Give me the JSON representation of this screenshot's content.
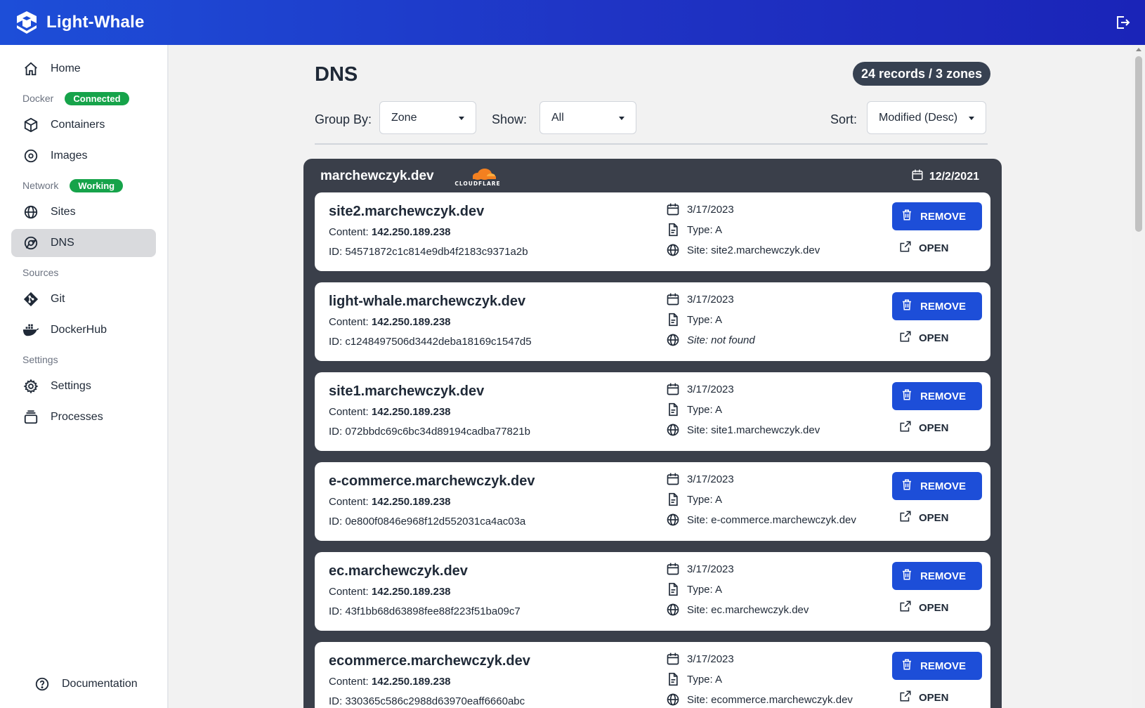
{
  "app": {
    "title": "Light-Whale"
  },
  "sidebar": {
    "home": "Home",
    "docker_section": "Docker",
    "docker_status": "Connected",
    "containers": "Containers",
    "images": "Images",
    "network_section": "Network",
    "network_status": "Working",
    "sites": "Sites",
    "dns": "DNS",
    "sources_section": "Sources",
    "git": "Git",
    "dockerhub": "DockerHub",
    "settings_section": "Settings",
    "settings": "Settings",
    "processes": "Processes",
    "documentation": "Documentation"
  },
  "page": {
    "title": "DNS",
    "summary": "24 records / 3 zones",
    "group_by_label": "Group By:",
    "group_by_value": "Zone",
    "show_label": "Show:",
    "show_value": "All",
    "sort_label": "Sort:",
    "sort_value": "Modified (Desc)"
  },
  "zone": {
    "name": "marchewczyk.dev",
    "provider": "CLOUDFLARE",
    "date": "12/2/2021"
  },
  "labels": {
    "content": "Content:",
    "remove": "REMOVE",
    "open": "OPEN"
  },
  "records": [
    {
      "name": "site2.marchewczyk.dev",
      "content": "142.250.189.238",
      "id": "ID: 54571872c1c814e9db4f2183c9371a2b",
      "date": "3/17/2023",
      "type": "Type: A",
      "site": "Site: site2.marchewczyk.dev"
    },
    {
      "name": "light-whale.marchewczyk.dev",
      "content": "142.250.189.238",
      "id": "ID: c1248497506d3442deba18169c1547d5",
      "date": "3/17/2023",
      "type": "Type: A",
      "site": "Site: not found"
    },
    {
      "name": "site1.marchewczyk.dev",
      "content": "142.250.189.238",
      "id": "ID: 072bbdc69c6bc34d89194cadba77821b",
      "date": "3/17/2023",
      "type": "Type: A",
      "site": "Site: site1.marchewczyk.dev"
    },
    {
      "name": "e-commerce.marchewczyk.dev",
      "content": "142.250.189.238",
      "id": "ID: 0e800f0846e968f12d552031ca4ac03a",
      "date": "3/17/2023",
      "type": "Type: A",
      "site": "Site: e-commerce.marchewczyk.dev"
    },
    {
      "name": "ec.marchewczyk.dev",
      "content": "142.250.189.238",
      "id": "ID: 43f1bb68d63898fee88f223f51ba09c7",
      "date": "3/17/2023",
      "type": "Type: A",
      "site": "Site: ec.marchewczyk.dev"
    },
    {
      "name": "ecommerce.marchewczyk.dev",
      "content": "142.250.189.238",
      "id": "ID: 330365c586c2988d63970eaff6660abc",
      "date": "3/17/2023",
      "type": "Type: A",
      "site": "Site: ecommerce.marchewczyk.dev"
    }
  ],
  "colors": {
    "header": "#1d4ed8",
    "badge": "#16a34a",
    "button": "#1d4ed8",
    "zone_bg": "#3a3f4a"
  }
}
